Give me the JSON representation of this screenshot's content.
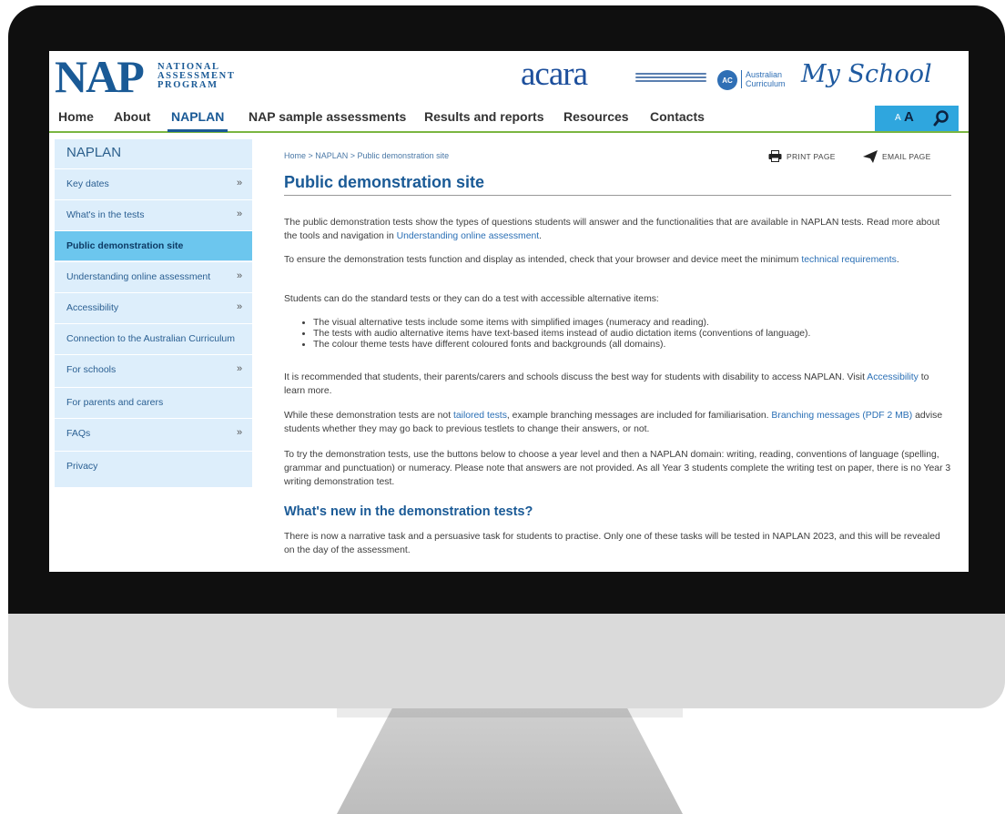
{
  "header": {
    "logo_main": "NAP",
    "logo_lines": [
      "NATIONAL",
      "ASSESSMENT",
      "PROGRAM"
    ],
    "acara": "acara",
    "ac_badge": "AC",
    "ac_text": "Australian Curriculum",
    "myschool": "My School"
  },
  "nav": {
    "items": [
      {
        "label": "Home"
      },
      {
        "label": "About"
      },
      {
        "label": "NAPLAN",
        "active": true
      },
      {
        "label": "NAP sample assessments"
      },
      {
        "label": "Results and reports"
      },
      {
        "label": "Resources"
      },
      {
        "label": "Contacts"
      }
    ],
    "text_small": "A",
    "text_large": "A",
    "accent_color": "#7ab640",
    "tool_color": "#2fa6de"
  },
  "sidebar": {
    "title": "NAPLAN",
    "items": [
      {
        "label": "Key dates",
        "chevron": "»"
      },
      {
        "label": "What's in the tests",
        "chevron": "»"
      },
      {
        "label": "Public demonstration site",
        "active": true
      },
      {
        "label": "Understanding online assessment",
        "chevron": "»"
      },
      {
        "label": "Accessibility",
        "chevron": "»"
      },
      {
        "label": "Connection to the Australian Curriculum"
      },
      {
        "label": "For schools",
        "chevron": "»"
      },
      {
        "label": "For parents and carers"
      },
      {
        "label": "FAQs",
        "chevron": "»"
      },
      {
        "label": "Privacy"
      }
    ]
  },
  "content": {
    "breadcrumb": "Home > NAPLAN > Public demonstration site",
    "print_label": "PRINT PAGE",
    "email_label": "EMAIL PAGE",
    "title": "Public demonstration site",
    "p1_a": "The public demonstration tests show the types of questions students will answer and the functionalities that are available in NAPLAN tests. Read more about the tools and navigation in ",
    "p1_link": "Understanding online assessment",
    "p1_b": ".",
    "p2_a": "To ensure the demonstration tests function and display as intended, check that your browser and device meet the minimum ",
    "p2_link": "technical requirements",
    "p2_b": ".",
    "p3": "Students can do the standard tests or they can do a test with accessible alternative items:",
    "bullets": [
      "The visual alternative tests include some items with simplified images (numeracy and reading).",
      "The tests with audio alternative items have text-based items instead of audio dictation items (conventions of language).",
      "The colour theme tests have different coloured fonts and backgrounds (all domains)."
    ],
    "p4_a": "It is recommended that students, their parents/carers and schools discuss the best way for students with disability to access NAPLAN. Visit ",
    "p4_link": "Accessibility",
    "p4_b": " to learn more.",
    "p5_a": "While these demonstration tests are not ",
    "p5_link1": "tailored tests",
    "p5_b": ", example branching messages are included for familiarisation. ",
    "p5_link2": "Branching messages (PDF 2 MB)",
    "p5_c": " advise students whether they may go back to previous testlets to change their answers, or not.",
    "p6": "To try the demonstration tests, use the buttons below to choose a year level and then a NAPLAN domain: writing, reading, conventions of language (spelling, grammar and punctuation) or numeracy. Please note that answers are not provided. As all Year 3 students complete the writing test on paper, there is no Year 3 writing demonstration test.",
    "subheading": "What's new in the demonstration tests?",
    "p7": "There is now a narrative task and a persuasive task for students to practise. Only one of these tasks will be tested in NAPLAN 2023, and this will be revealed on the day of the assessment."
  }
}
